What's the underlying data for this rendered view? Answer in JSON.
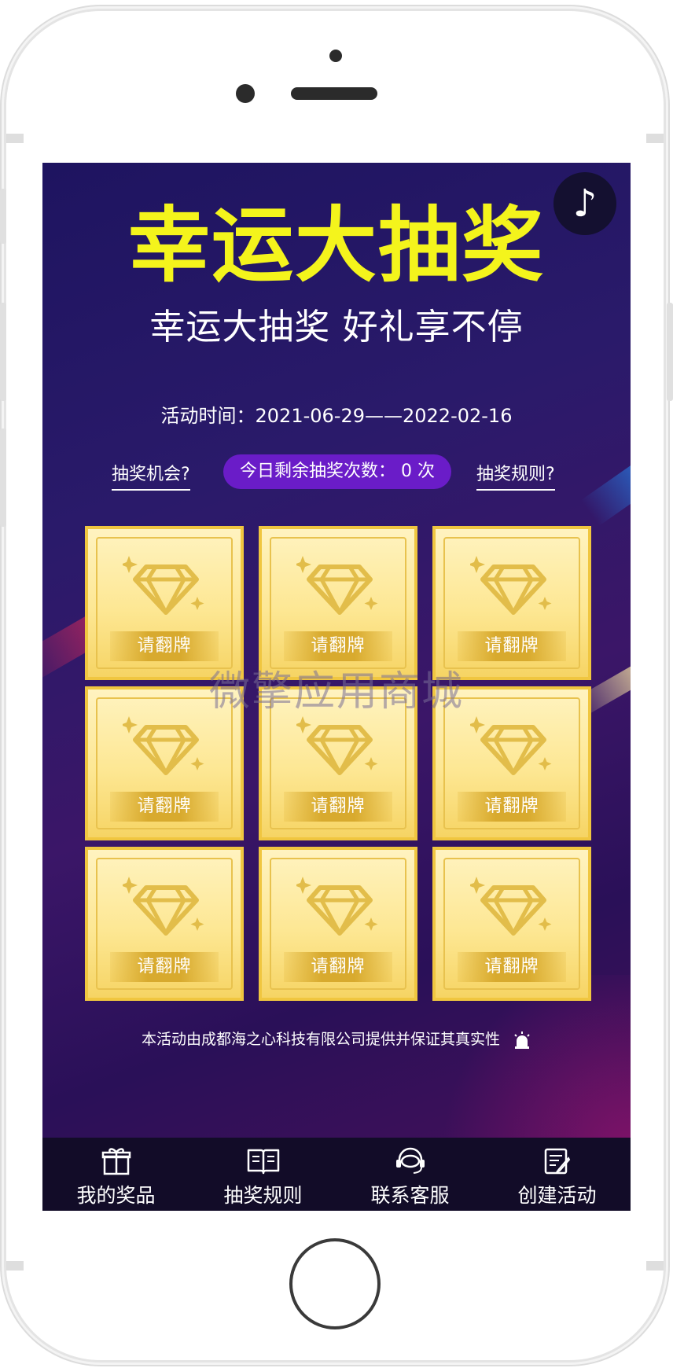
{
  "header": {
    "title": "幸运大抽奖",
    "subtitle": "幸运大抽奖 好礼享不停",
    "music_icon": "music-note-icon"
  },
  "activity": {
    "time_label": "活动时间：",
    "time_range": "2021-06-29——2022-02-16"
  },
  "actions": {
    "chance_link": "抽奖机会?",
    "remaining_text": "今日剩余抽奖次数： 0 次",
    "rules_link": "抽奖规则?"
  },
  "cards": [
    {
      "label": "请翻牌"
    },
    {
      "label": "请翻牌"
    },
    {
      "label": "请翻牌"
    },
    {
      "label": "请翻牌"
    },
    {
      "label": "请翻牌"
    },
    {
      "label": "请翻牌"
    },
    {
      "label": "请翻牌"
    },
    {
      "label": "请翻牌"
    },
    {
      "label": "请翻牌"
    }
  ],
  "watermark": "微擎应用商城",
  "footer_note": "本活动由成都海之心科技有限公司提供并保证其真实性",
  "tabbar": [
    {
      "label": "我的奖品",
      "icon": "gift-icon"
    },
    {
      "label": "抽奖规则",
      "icon": "book-icon"
    },
    {
      "label": "联系客服",
      "icon": "headset-icon"
    },
    {
      "label": "创建活动",
      "icon": "edit-note-icon"
    }
  ],
  "colors": {
    "title": "#f4f41c",
    "card": "#fde793",
    "pill": "#6a1cc8",
    "tabbar": "#120c28"
  }
}
